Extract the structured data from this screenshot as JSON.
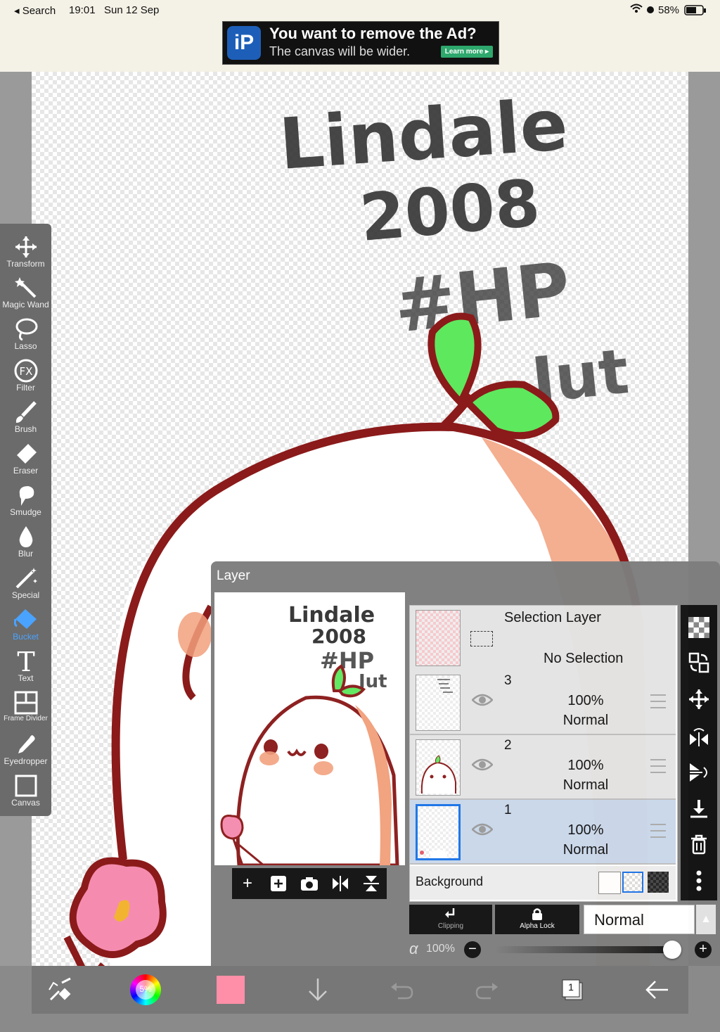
{
  "status_bar": {
    "back_label": "◂ Search",
    "time": "19:01",
    "date": "Sun 12 Sep",
    "battery": "58%"
  },
  "ad": {
    "logo": "iP",
    "headline": "You want to remove the Ad?",
    "subline": "The canvas will be wider.",
    "cta": "Learn more ▸"
  },
  "canvas_text": {
    "line1": "Lindale",
    "line2": "2008",
    "line3": "#HP",
    "line4": "Jut"
  },
  "tools": [
    {
      "label": "Transform",
      "icon": "transform-icon"
    },
    {
      "label": "Magic Wand",
      "icon": "magic-wand-icon"
    },
    {
      "label": "Lasso",
      "icon": "lasso-icon"
    },
    {
      "label": "Filter",
      "icon": "fx-icon"
    },
    {
      "label": "Brush",
      "icon": "brush-icon"
    },
    {
      "label": "Eraser",
      "icon": "eraser-icon"
    },
    {
      "label": "Smudge",
      "icon": "smudge-icon"
    },
    {
      "label": "Blur",
      "icon": "blur-icon"
    },
    {
      "label": "Special",
      "icon": "special-icon"
    },
    {
      "label": "Bucket",
      "icon": "bucket-icon",
      "active": true
    },
    {
      "label": "Text",
      "icon": "text-icon"
    },
    {
      "label": "Frame Divider",
      "icon": "frame-divider-icon"
    },
    {
      "label": "Eyedropper",
      "icon": "eyedropper-icon"
    },
    {
      "label": "Canvas",
      "icon": "canvas-icon"
    }
  ],
  "layer_panel": {
    "title": "Layer",
    "selection_layer": {
      "name": "Selection Layer",
      "status": "No Selection"
    },
    "layers": [
      {
        "number": "3",
        "opacity": "100%",
        "mode": "Normal",
        "selected": false
      },
      {
        "number": "2",
        "opacity": "100%",
        "mode": "Normal",
        "selected": false
      },
      {
        "number": "1",
        "opacity": "100%",
        "mode": "Normal",
        "selected": true
      }
    ],
    "background_label": "Background",
    "clipping_label": "Clipping",
    "alpha_lock_label": "Alpha Lock",
    "blend_mode": "Normal",
    "alpha_symbol": "α",
    "alpha_value": "100%",
    "opacity_level": 1.0
  },
  "bottom_bar": {
    "color_wheel_label": "5%",
    "current_color": "#ff8fa8",
    "layer_count": "1"
  },
  "colors": {
    "accent": "#4aa3ff",
    "selected_layer": "#c9d7ea",
    "outline": "#8b1a1a",
    "leaf": "#5ee85e",
    "blush": "#f0a07c"
  }
}
